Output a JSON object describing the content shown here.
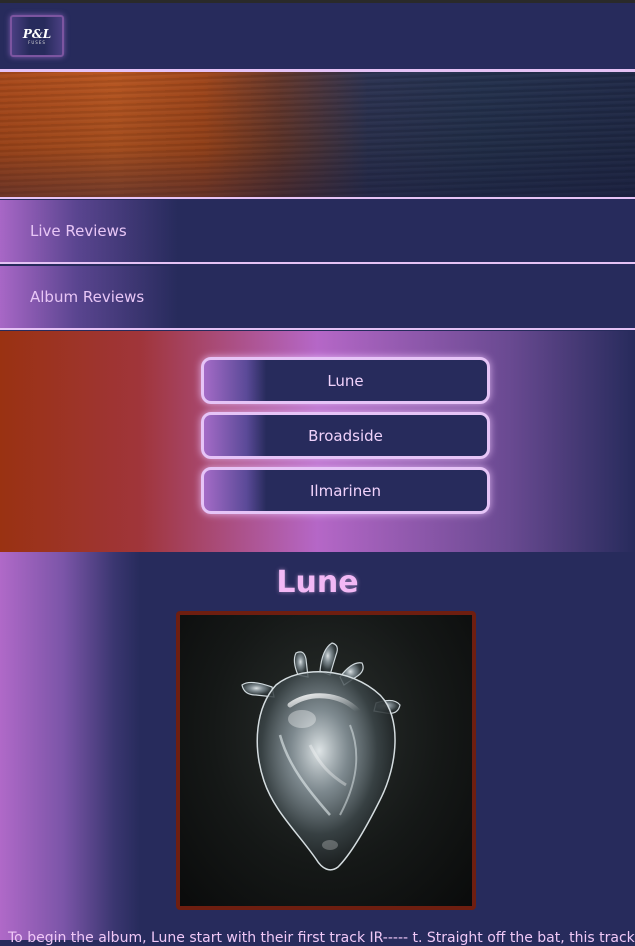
{
  "header": {
    "logo_text": "P&L",
    "logo_sub": "FUSES"
  },
  "nav": {
    "items": [
      {
        "label": "Live Reviews"
      },
      {
        "label": "Album Reviews"
      }
    ]
  },
  "album_menu": {
    "items": [
      {
        "label": "Lune"
      },
      {
        "label": "Broadside"
      },
      {
        "label": "Ilmarinen"
      }
    ]
  },
  "review": {
    "title": "Lune",
    "cover_alt": "Glass anatomical heart on black background",
    "intro_text": "To begin the album, Lune start with their first track IR----- t. Straight off the bat, this track"
  },
  "colors": {
    "navy": "#272b5c",
    "lavender": "#e5c2f5",
    "title_pink": "#f2b8f5",
    "rust": "#9a3212",
    "cover_border": "#6e1e10"
  }
}
